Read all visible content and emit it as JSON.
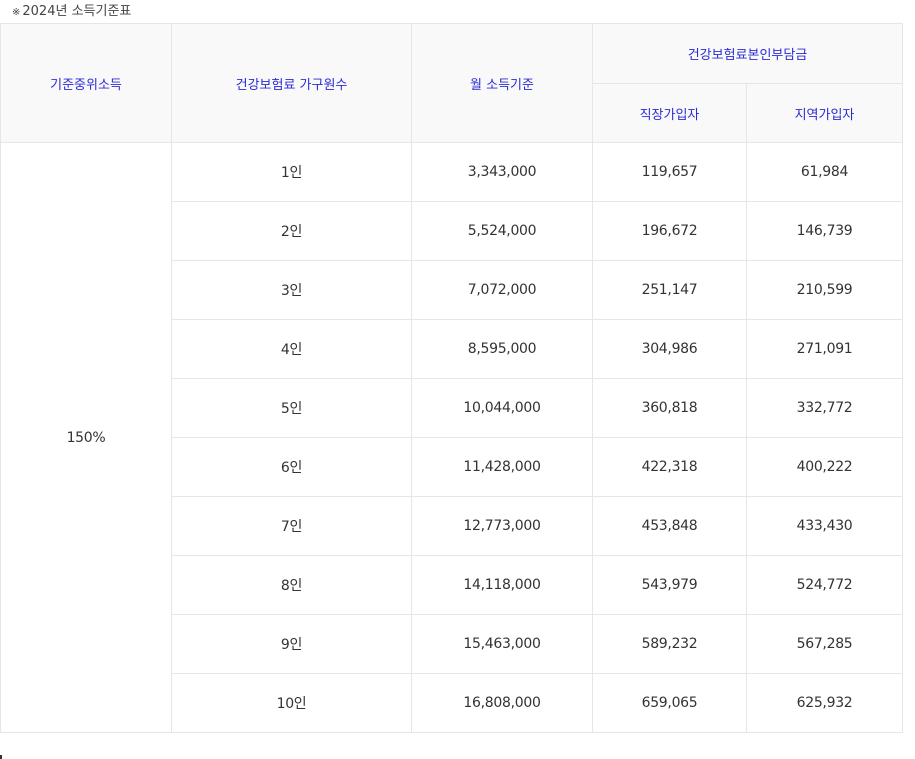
{
  "note": {
    "mark": "※",
    "text": "2024년 소득기준표"
  },
  "table": {
    "headers": {
      "median": "기준중위소득",
      "household": "건강보험료 가구원수",
      "monthly": "월 소득기준",
      "premium_group": "건강보험료본인부담금",
      "employee": "직장가입자",
      "regional": "지역가입자"
    },
    "median_value": "150%",
    "rows": [
      {
        "household": "1인",
        "monthly": "3,343,000",
        "employee": "119,657",
        "regional": "61,984"
      },
      {
        "household": "2인",
        "monthly": "5,524,000",
        "employee": "196,672",
        "regional": "146,739"
      },
      {
        "household": "3인",
        "monthly": "7,072,000",
        "employee": "251,147",
        "regional": "210,599"
      },
      {
        "household": "4인",
        "monthly": "8,595,000",
        "employee": "304,986",
        "regional": "271,091"
      },
      {
        "household": "5인",
        "monthly": "10,044,000",
        "employee": "360,818",
        "regional": "332,772"
      },
      {
        "household": "6인",
        "monthly": "11,428,000",
        "employee": "422,318",
        "regional": "400,222"
      },
      {
        "household": "7인",
        "monthly": "12,773,000",
        "employee": "453,848",
        "regional": "433,430"
      },
      {
        "household": "8인",
        "monthly": "14,118,000",
        "employee": "543,979",
        "regional": "524,772"
      },
      {
        "household": "9인",
        "monthly": "15,463,000",
        "employee": "589,232",
        "regional": "567,285"
      },
      {
        "household": "10인",
        "monthly": "16,808,000",
        "employee": "659,065",
        "regional": "625,932"
      }
    ]
  }
}
